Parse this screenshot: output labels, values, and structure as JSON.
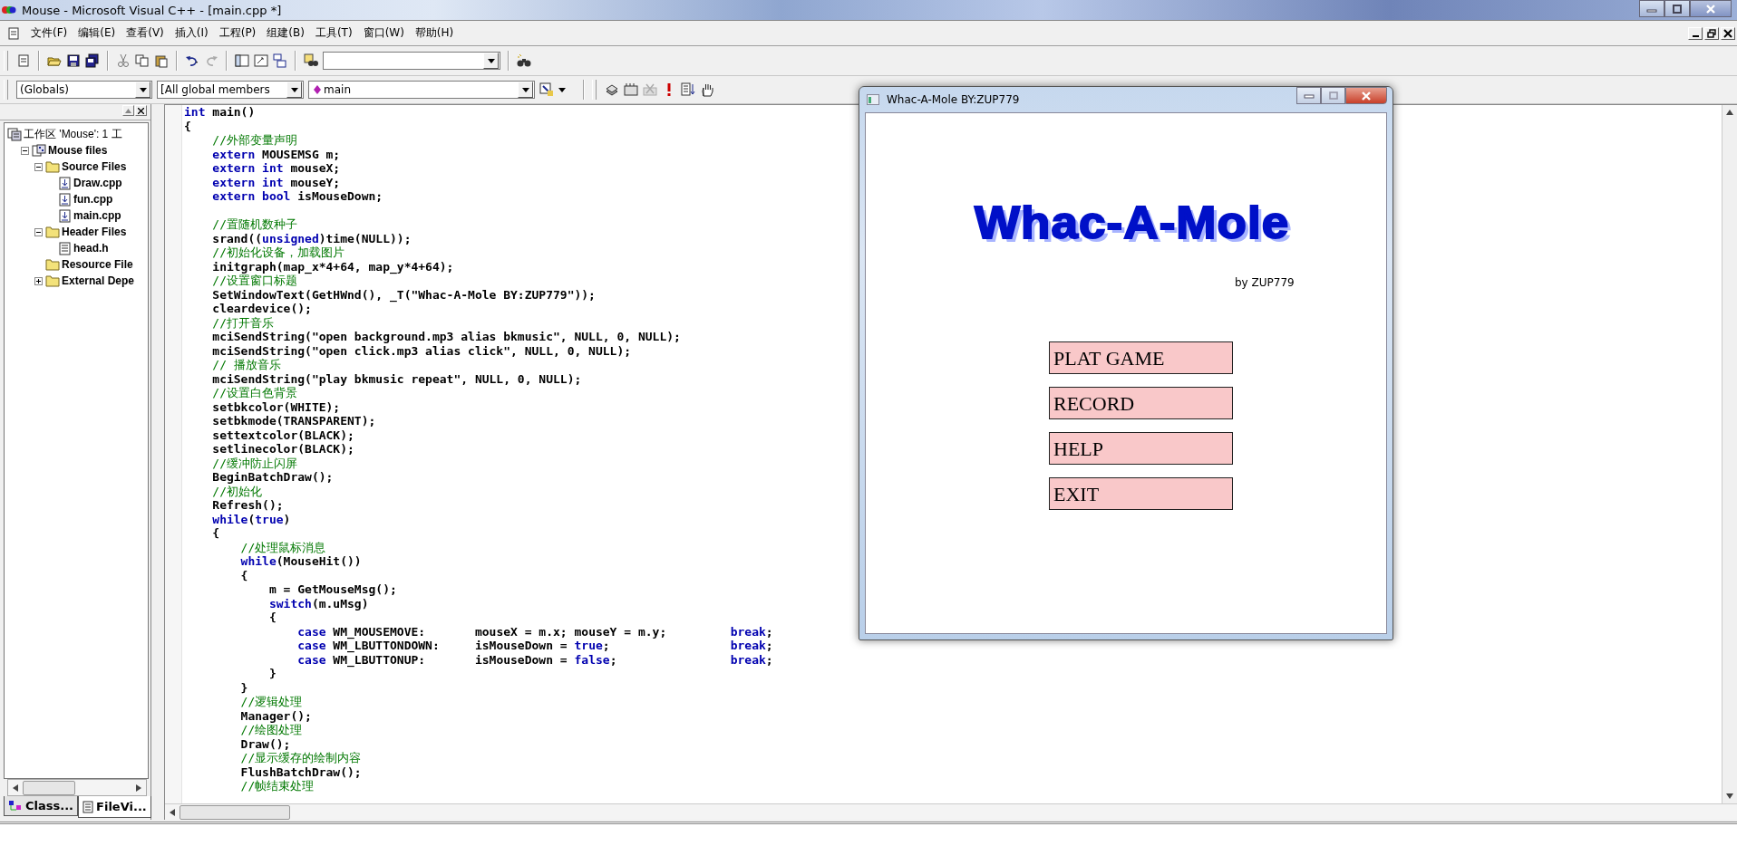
{
  "window": {
    "title": "Mouse - Microsoft Visual C++ - [main.cpp *]"
  },
  "menu": [
    "文件(F)",
    "编辑(E)",
    "查看(V)",
    "插入(I)",
    "工程(P)",
    "组建(B)",
    "工具(T)",
    "窗口(W)",
    "帮助(H)"
  ],
  "wizard_bar": {
    "combos": [
      {
        "value": "(Globals)"
      },
      {
        "value": "[All global members"
      },
      {
        "value": "main"
      }
    ]
  },
  "workspace": {
    "tree": [
      {
        "label": "工作区 'Mouse': 1 工",
        "kind": "workspace",
        "children": [
          {
            "label": "Mouse files",
            "kind": "project",
            "expanded": true,
            "children": [
              {
                "label": "Source Files",
                "kind": "folder",
                "expanded": true,
                "children": [
                  {
                    "label": "Draw.cpp",
                    "kind": "source"
                  },
                  {
                    "label": "fun.cpp",
                    "kind": "source"
                  },
                  {
                    "label": "main.cpp",
                    "kind": "source"
                  }
                ]
              },
              {
                "label": "Header Files",
                "kind": "folder",
                "expanded": true,
                "children": [
                  {
                    "label": "head.h",
                    "kind": "header"
                  }
                ]
              },
              {
                "label": "Resource File",
                "kind": "folder"
              },
              {
                "label": "External Depe",
                "kind": "folder",
                "expanded": false
              }
            ]
          }
        ]
      }
    ],
    "tabs": [
      {
        "label": "Class...",
        "kind": "class",
        "selected": false
      },
      {
        "label": "FileVi...",
        "kind": "file",
        "selected": true
      }
    ]
  },
  "editor": {
    "lines": [
      {
        "segments": [
          {
            "kind": "keyword",
            "text": "int"
          },
          {
            "kind": "plain",
            "text": " main()"
          }
        ]
      },
      {
        "segments": [
          {
            "kind": "plain",
            "text": "{"
          }
        ]
      },
      {
        "segments": [
          {
            "kind": "comment",
            "text": "    //外部变量声明"
          }
        ]
      },
      {
        "segments": [
          {
            "kind": "keyword",
            "text": "    extern"
          },
          {
            "kind": "plain",
            "text": " MOUSEMSG m;"
          }
        ]
      },
      {
        "segments": [
          {
            "kind": "keyword",
            "text": "    extern int"
          },
          {
            "kind": "plain",
            "text": " mouseX;"
          }
        ]
      },
      {
        "segments": [
          {
            "kind": "keyword",
            "text": "    extern int"
          },
          {
            "kind": "plain",
            "text": " mouseY;"
          }
        ]
      },
      {
        "segments": [
          {
            "kind": "keyword",
            "text": "    extern bool"
          },
          {
            "kind": "plain",
            "text": " isMouseDown;"
          }
        ]
      },
      {
        "blank_before": true,
        "segments": [
          {
            "kind": "comment",
            "text": "    //置随机数种子"
          }
        ]
      },
      {
        "segments": [
          {
            "kind": "plain",
            "text": "    srand(("
          },
          {
            "kind": "keyword",
            "text": "unsigned"
          },
          {
            "kind": "plain",
            "text": ")time(NULL));"
          }
        ]
      },
      {
        "segments": [
          {
            "kind": "comment",
            "text": "    //初始化设备，加载图片"
          }
        ]
      },
      {
        "segments": [
          {
            "kind": "plain",
            "text": "    initgraph(map_x*4+64, map_y*4+64);"
          }
        ]
      },
      {
        "segments": [
          {
            "kind": "comment",
            "text": "    //设置窗口标题"
          }
        ]
      },
      {
        "segments": [
          {
            "kind": "plain",
            "text": "    SetWindowText(GetHWnd(), _T(\"Whac-A-Mole BY:ZUP779\"));"
          }
        ]
      },
      {
        "segments": [
          {
            "kind": "plain",
            "text": "    cleardevice();"
          }
        ]
      },
      {
        "segments": [
          {
            "kind": "comment",
            "text": "    //打开音乐"
          }
        ]
      },
      {
        "segments": [
          {
            "kind": "plain",
            "text": "    mciSendString(\"open background.mp3 alias bkmusic\", NULL, 0, NULL);"
          }
        ]
      },
      {
        "segments": [
          {
            "kind": "plain",
            "text": "    mciSendString(\"open click.mp3 alias click\", NULL, 0, NULL);"
          }
        ]
      },
      {
        "segments": [
          {
            "kind": "comment",
            "text": "    // 播放音乐"
          }
        ]
      },
      {
        "segments": [
          {
            "kind": "plain",
            "text": "    mciSendString(\"play bkmusic repeat\", NULL, 0, NULL);"
          }
        ]
      },
      {
        "segments": [
          {
            "kind": "comment",
            "text": "    //设置白色背景"
          }
        ]
      },
      {
        "segments": [
          {
            "kind": "plain",
            "text": "    setbkcolor(WHITE);"
          }
        ]
      },
      {
        "segments": [
          {
            "kind": "plain",
            "text": "    setbkmode(TRANSPARENT);"
          }
        ]
      },
      {
        "segments": [
          {
            "kind": "plain",
            "text": "    settextcolor(BLACK);"
          }
        ]
      },
      {
        "segments": [
          {
            "kind": "plain",
            "text": "    setlinecolor(BLACK);"
          }
        ]
      },
      {
        "segments": [
          {
            "kind": "comment",
            "text": "    //缓冲防止闪屏"
          }
        ]
      },
      {
        "segments": [
          {
            "kind": "plain",
            "text": "    BeginBatchDraw();"
          }
        ]
      },
      {
        "segments": [
          {
            "kind": "comment",
            "text": "    //初始化"
          }
        ]
      },
      {
        "segments": [
          {
            "kind": "plain",
            "text": "    Refresh();"
          }
        ]
      },
      {
        "segments": [
          {
            "kind": "keyword",
            "text": "    while"
          },
          {
            "kind": "plain",
            "text": "("
          },
          {
            "kind": "keyword",
            "text": "true"
          },
          {
            "kind": "plain",
            "text": ")"
          }
        ]
      },
      {
        "segments": [
          {
            "kind": "plain",
            "text": "    {"
          }
        ]
      },
      {
        "segments": [
          {
            "kind": "comment",
            "text": "        //处理鼠标消息"
          }
        ]
      },
      {
        "segments": [
          {
            "kind": "keyword",
            "text": "        while"
          },
          {
            "kind": "plain",
            "text": "(MouseHit())"
          }
        ]
      },
      {
        "segments": [
          {
            "kind": "plain",
            "text": "        {"
          }
        ]
      },
      {
        "segments": [
          {
            "kind": "plain",
            "text": "            m = GetMouseMsg();"
          }
        ]
      },
      {
        "segments": [
          {
            "kind": "keyword",
            "text": "            switch"
          },
          {
            "kind": "plain",
            "text": "(m.uMsg)"
          }
        ]
      },
      {
        "segments": [
          {
            "kind": "plain",
            "text": "            {"
          }
        ]
      },
      {
        "segments": [
          {
            "kind": "keyword",
            "text": "                case"
          },
          {
            "kind": "plain",
            "text": " WM_MOUSEMOVE:       mouseX = m.x; mouseY = m.y;         "
          },
          {
            "kind": "keyword",
            "text": "break"
          },
          {
            "kind": "plain",
            "text": ";"
          }
        ]
      },
      {
        "segments": [
          {
            "kind": "keyword",
            "text": "                case"
          },
          {
            "kind": "plain",
            "text": " WM_LBUTTONDOWN:     isMouseDown = "
          },
          {
            "kind": "keyword",
            "text": "true"
          },
          {
            "kind": "plain",
            "text": ";                 "
          },
          {
            "kind": "keyword",
            "text": "break"
          },
          {
            "kind": "plain",
            "text": ";"
          }
        ]
      },
      {
        "segments": [
          {
            "kind": "keyword",
            "text": "                case"
          },
          {
            "kind": "plain",
            "text": " WM_LBUTTONUP:       isMouseDown = "
          },
          {
            "kind": "keyword",
            "text": "false"
          },
          {
            "kind": "plain",
            "text": ";                "
          },
          {
            "kind": "keyword",
            "text": "break"
          },
          {
            "kind": "plain",
            "text": ";"
          }
        ]
      },
      {
        "segments": [
          {
            "kind": "plain",
            "text": "            }"
          }
        ]
      },
      {
        "segments": [
          {
            "kind": "plain",
            "text": "        }"
          }
        ]
      },
      {
        "segments": [
          {
            "kind": "comment",
            "text": "        //逻辑处理"
          }
        ]
      },
      {
        "segments": [
          {
            "kind": "plain",
            "text": "        Manager();"
          }
        ]
      },
      {
        "segments": [
          {
            "kind": "comment",
            "text": "        //绘图处理"
          }
        ]
      },
      {
        "segments": [
          {
            "kind": "plain",
            "text": "        Draw();"
          }
        ]
      },
      {
        "segments": [
          {
            "kind": "comment",
            "text": "        //显示缓存的绘制内容"
          }
        ]
      },
      {
        "segments": [
          {
            "kind": "plain",
            "text": "        FlushBatchDraw();"
          }
        ]
      },
      {
        "segments": [
          {
            "kind": "comment",
            "text": "        //帧结束处理"
          }
        ]
      }
    ]
  },
  "game_window": {
    "title": "Whac-A-Mole BY:ZUP779",
    "logo": "Whac-A-Mole",
    "byline": "by ZUP779",
    "buttons": [
      "PLAT GAME",
      "RECORD",
      "HELP",
      "EXIT"
    ]
  }
}
